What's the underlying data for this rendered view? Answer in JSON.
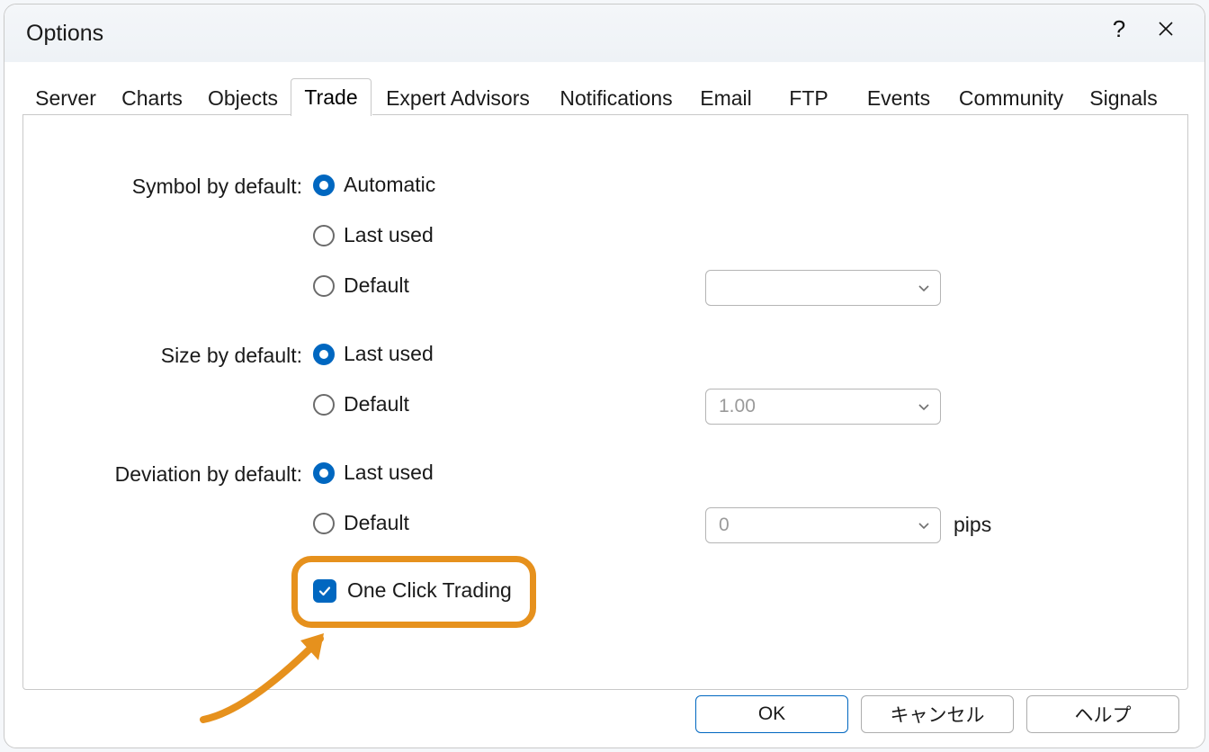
{
  "window": {
    "title": "Options"
  },
  "tabs": [
    "Server",
    "Charts",
    "Objects",
    "Trade",
    "Expert Advisors",
    "Notifications",
    "Email",
    "FTP",
    "Events",
    "Community",
    "Signals"
  ],
  "trade": {
    "symbol_label": "Symbol by default:",
    "symbol_opts": {
      "automatic": "Automatic",
      "last_used": "Last used",
      "default": "Default"
    },
    "symbol_combo": "",
    "size_label": "Size by default:",
    "size_opts": {
      "last_used": "Last used",
      "default": "Default"
    },
    "size_combo": "1.00",
    "dev_label": "Deviation by default:",
    "dev_opts": {
      "last_used": "Last used",
      "default": "Default"
    },
    "dev_combo": "0",
    "dev_suffix": "pips",
    "one_click": "One Click Trading"
  },
  "buttons": {
    "ok": "OK",
    "cancel": "キャンセル",
    "help": "ヘルプ"
  }
}
